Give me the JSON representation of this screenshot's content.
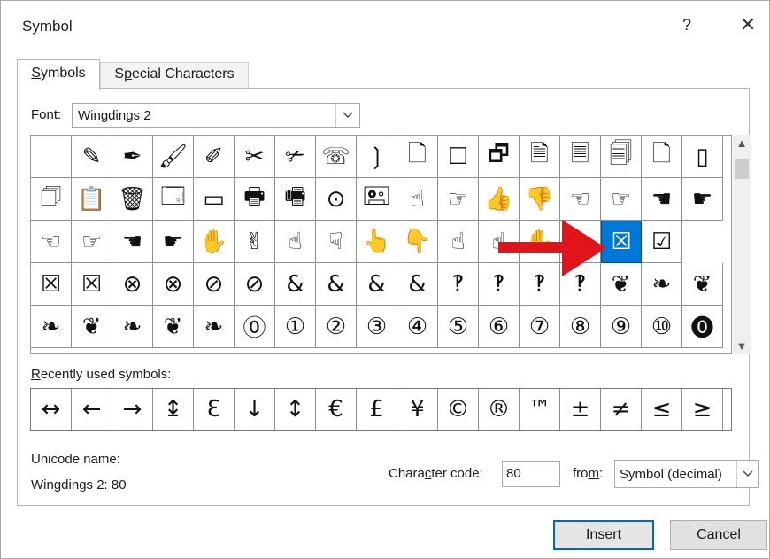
{
  "dialog": {
    "title": "Symbol",
    "help_label": "?",
    "close_label": "✕"
  },
  "tabs": [
    {
      "label_u": "S",
      "label_rest": "ymbols",
      "active": true
    },
    {
      "label_pre": "S",
      "label_u": "p",
      "label_rest": "ecial Characters",
      "active": false
    }
  ],
  "font": {
    "label_u": "F",
    "label_rest": "ont:",
    "value": "Wingdings 2"
  },
  "symbols": [
    [
      "",
      "✎",
      "✒",
      "🖌",
      "✐",
      "✂",
      "✃",
      "☏",
      "❳",
      "🗋",
      "☐",
      "🗗",
      "🗎",
      "🗏",
      "🗐",
      "🗋",
      "▯"
    ],
    [
      "🗇",
      "📋",
      "🗑",
      "🗔",
      "▭",
      "🖶",
      "🖷",
      "⊙",
      "🖭",
      "☝",
      "☞",
      "👍",
      "👎",
      "☜",
      "☞",
      "☚",
      "☛"
    ],
    [
      "☜",
      "☞",
      "☚",
      "☛",
      "✋",
      "✌",
      "☝",
      "☟",
      "👆",
      "👇",
      "☝",
      "☝",
      "✋",
      "✓",
      "☒",
      "☑"
    ],
    [
      "☒",
      "☒",
      "⊗",
      "⊗",
      "⊘",
      "⊘",
      "&",
      "&",
      "&",
      "&",
      "‽",
      "‽",
      "‽",
      "‽",
      "❦",
      "❧",
      "❦"
    ],
    [
      "❧",
      "❦",
      "❧",
      "❦",
      "❧",
      "⓪",
      "①",
      "②",
      "③",
      "④",
      "⑤",
      "⑥",
      "⑦",
      "⑧",
      "⑨",
      "⑩",
      "⓿"
    ]
  ],
  "selected": {
    "row": 2,
    "col": 14
  },
  "recent": {
    "label_u": "R",
    "label_rest": "ecently used symbols:",
    "items": [
      "↔",
      "←",
      "→",
      "↨",
      "Ɛ",
      "↓",
      "↕",
      "€",
      "£",
      "¥",
      "©",
      "®",
      "™",
      "±",
      "≠",
      "≤",
      "≥"
    ]
  },
  "unicode": {
    "label": "Unicode name:",
    "value": "Wingdings 2: 80"
  },
  "code": {
    "label_pre": "Chara",
    "label_u": "c",
    "label_rest": "ter code:",
    "value": "80"
  },
  "from": {
    "label_pre": "fro",
    "label_u": "m",
    "label_rest": ":",
    "value": "Symbol (decimal)"
  },
  "buttons": {
    "insert_u": "I",
    "insert_rest": "nsert",
    "cancel": "Cancel"
  },
  "colors": {
    "selection": "#0078d7",
    "arrow": "#e0141a",
    "default_border": "#0a64c8"
  }
}
